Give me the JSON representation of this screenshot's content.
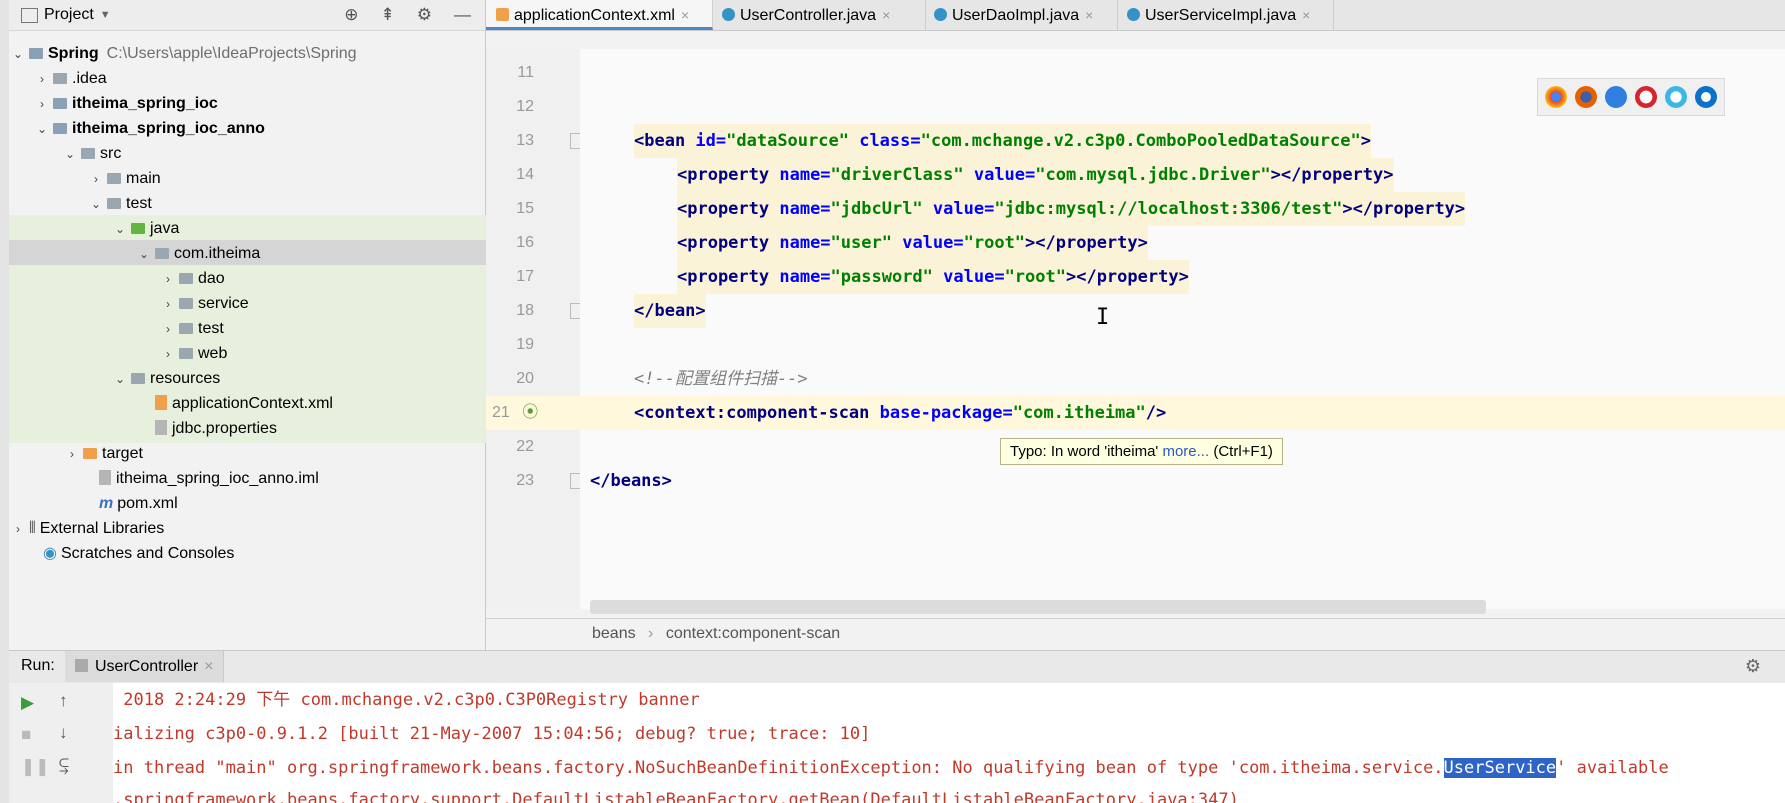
{
  "project_panel": {
    "title": "Project",
    "tree": [
      {
        "label": "Spring",
        "path": "C:\\Users\\apple\\IdeaProjects\\Spring"
      },
      {
        "label": ".idea"
      },
      {
        "label": "itheima_spring_ioc"
      },
      {
        "label": "itheima_spring_ioc_anno"
      },
      {
        "label": "src"
      },
      {
        "label": "main"
      },
      {
        "label": "test"
      },
      {
        "label": "java"
      },
      {
        "label": "com.itheima"
      },
      {
        "label": "dao"
      },
      {
        "label": "service"
      },
      {
        "label": "test"
      },
      {
        "label": "web"
      },
      {
        "label": "resources"
      },
      {
        "label": "applicationContext.xml"
      },
      {
        "label": "jdbc.properties"
      },
      {
        "label": "target"
      },
      {
        "label": "itheima_spring_ioc_anno.iml"
      },
      {
        "label": "pom.xml"
      },
      {
        "label": "External Libraries"
      },
      {
        "label": "Scratches and Consoles"
      }
    ]
  },
  "editor": {
    "tabs": [
      "applicationContext.xml",
      "UserController.java",
      "UserDaoImpl.java",
      "UserServiceImpl.java"
    ],
    "line_numbers": [
      "11",
      "12",
      "13",
      "14",
      "15",
      "16",
      "17",
      "18",
      "19",
      "20",
      "21",
      "22",
      "23"
    ],
    "code": {
      "l13": {
        "open": "<bean ",
        "a1": "id=",
        "v1": "\"dataSource\"",
        "a2": " class=",
        "v2": "\"com.mchange.v2.c3p0.ComboPooledDataSource\"",
        "close": ">"
      },
      "l14": {
        "open": "<property ",
        "a1": "name=",
        "v1": "\"driverClass\"",
        "a2": " value=",
        "v2": "\"com.mysql.jdbc.Driver\"",
        "close": "></property>"
      },
      "l15": {
        "open": "<property ",
        "a1": "name=",
        "v1": "\"jdbcUrl\"",
        "a2": " value=",
        "v2": "\"jdbc:mysql://localhost:3306/test\"",
        "close": "></property>"
      },
      "l16": {
        "open": "<property ",
        "a1": "name=",
        "v1": "\"user\"",
        "a2": " value=",
        "v2": "\"root\"",
        "close": "></property>"
      },
      "l17": {
        "open": "<property ",
        "a1": "name=",
        "v1": "\"password\"",
        "a2": " value=",
        "v2": "\"root\"",
        "close": "></property>"
      },
      "l18": "</bean>",
      "l20": "<!--配置组件扫描-->",
      "l21": {
        "open": "<context:component-scan ",
        "a1": "base-package=",
        "v1": "\"com.itheima\"",
        "close": "/>"
      },
      "l23": "</beans>"
    },
    "tooltip": {
      "text": "Typo: In word 'itheima'",
      "link": "more...",
      "shortcut": "(Ctrl+F1)"
    },
    "breadcrumb": [
      "beans",
      "context:component-scan"
    ],
    "browser_icons": [
      "chrome-icon",
      "firefox-icon",
      "safari-icon",
      "opera-icon",
      "ie-icon",
      "edge-icon"
    ]
  },
  "run": {
    "label": "Run:",
    "tab": "UserController",
    "console": [
      " 2018 2:24:29 下午 com.mchange.v2.c3p0.C3P0Registry banner",
      "ializing c3p0-0.9.1.2 [built 21-May-2007 15:04:56; debug? true; trace: 10]",
      {
        "pre": "in thread \"main\" org.springframework.beans.factory.NoSuchBeanDefinitionException: No qualifying bean of type 'com.itheima.service.",
        "sel": "UserService",
        "post": "' available"
      },
      ".springframework.beans.factory.support.DefaultListableBeanFactory.getBean(DefaultListableBeanFactory.java:347)"
    ]
  },
  "colors": {
    "accent": "#4a88c7",
    "error_text": "#c0392b",
    "selection": "#2e63c7"
  }
}
